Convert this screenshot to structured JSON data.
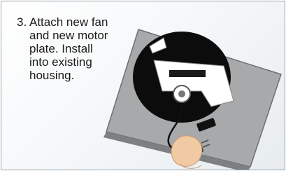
{
  "instruction": {
    "step_number": "3.",
    "text": "Attach new fan\nand new motor\nplate. Install\ninto existing\nhousing."
  }
}
